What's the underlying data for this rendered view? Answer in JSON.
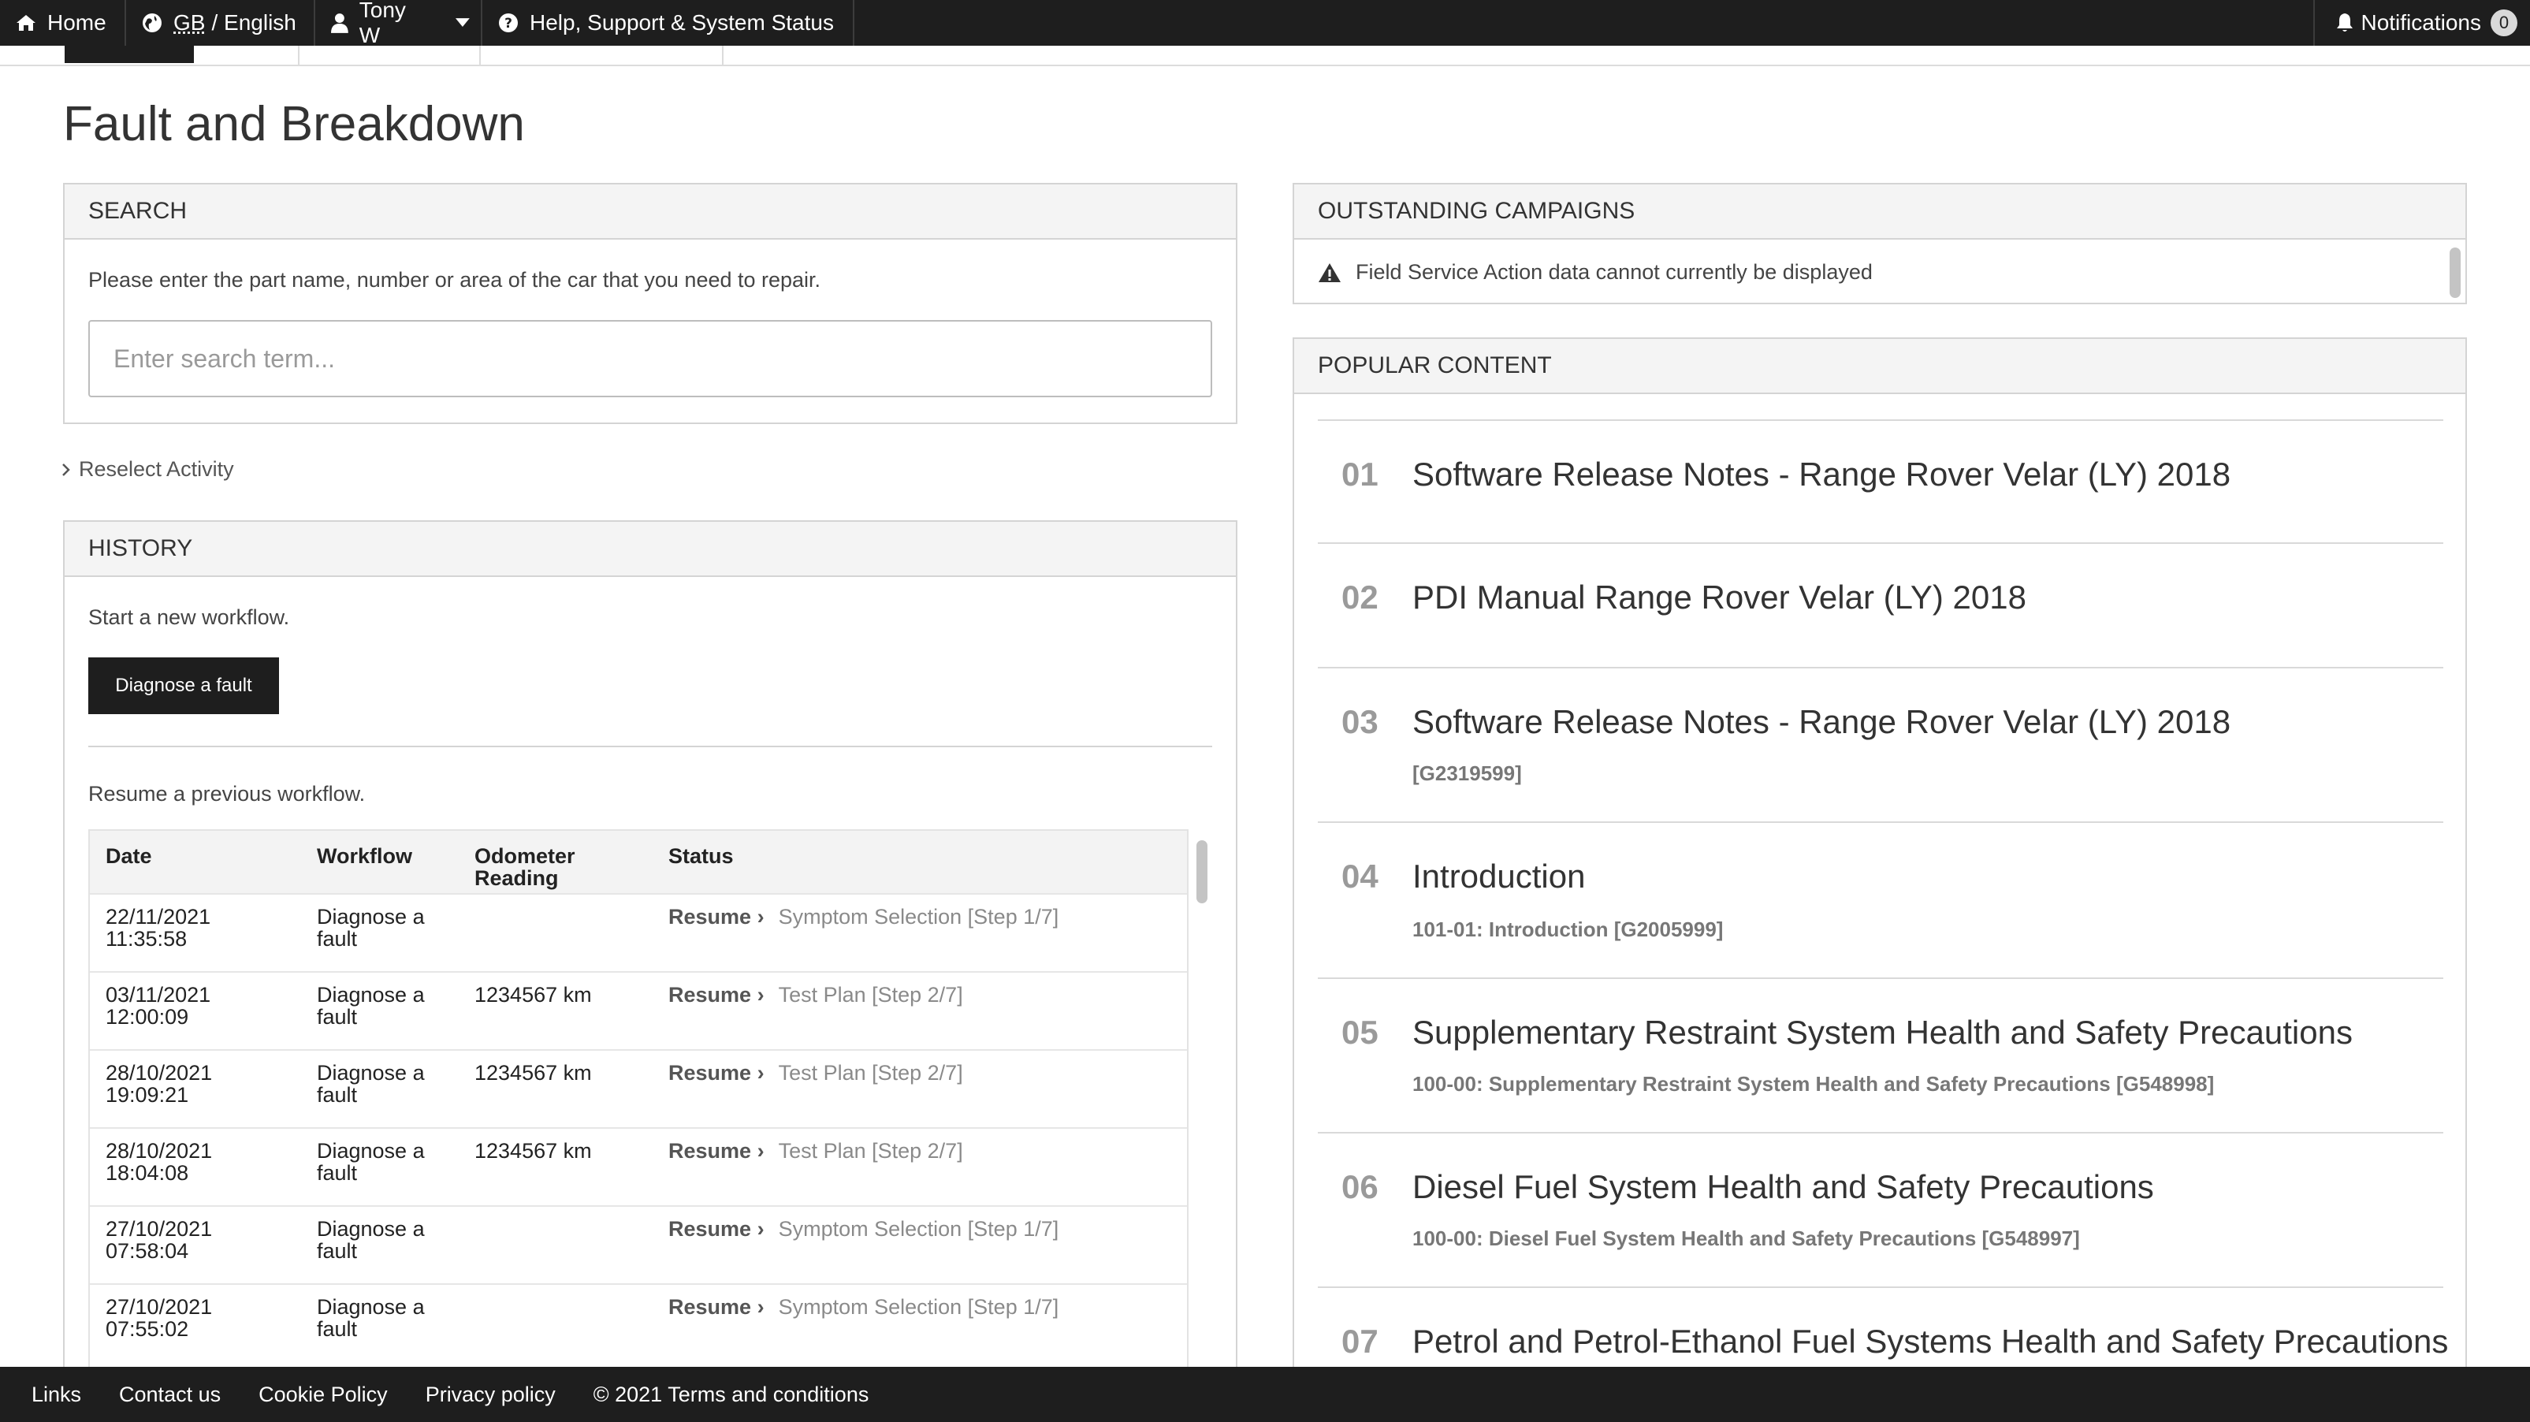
{
  "topbar": {
    "home": "Home",
    "region": "GB",
    "language": "/ English",
    "user": "Tony W",
    "help": "Help, Support & System Status",
    "notifications": "Notifications",
    "notification_count": "0"
  },
  "page_title": "Fault and Breakdown",
  "search": {
    "heading": "SEARCH",
    "instruction": "Please enter the part name, number or area of the car that you need to repair.",
    "placeholder": "Enter search term..."
  },
  "reselect": "Reselect Activity",
  "history": {
    "heading": "HISTORY",
    "start_text": "Start a new workflow.",
    "diagnose_button": "Diagnose a fault",
    "resume_text": "Resume a previous workflow.",
    "columns": [
      "Date",
      "Workflow",
      "Odometer Reading",
      "Status"
    ],
    "resume_label": "Resume",
    "rows": [
      {
        "date": "22/11/2021 11:35:58",
        "workflow": "Diagnose a fault",
        "odometer": "",
        "status": "Symptom Selection [Step 1/7]"
      },
      {
        "date": "03/11/2021 12:00:09",
        "workflow": "Diagnose a fault",
        "odometer": "1234567 km",
        "status": "Test Plan [Step 2/7]"
      },
      {
        "date": "28/10/2021 19:09:21",
        "workflow": "Diagnose a fault",
        "odometer": "1234567 km",
        "status": "Test Plan [Step 2/7]"
      },
      {
        "date": "28/10/2021 18:04:08",
        "workflow": "Diagnose a fault",
        "odometer": "1234567 km",
        "status": "Test Plan [Step 2/7]"
      },
      {
        "date": "27/10/2021 07:58:04",
        "workflow": "Diagnose a fault",
        "odometer": "",
        "status": "Symptom Selection [Step 1/7]"
      },
      {
        "date": "27/10/2021 07:55:02",
        "workflow": "Diagnose a fault",
        "odometer": "",
        "status": "Symptom Selection [Step 1/7]"
      }
    ]
  },
  "campaigns": {
    "heading": "OUTSTANDING CAMPAIGNS",
    "message": "Field Service Action data cannot currently be displayed"
  },
  "popular": {
    "heading": "POPULAR CONTENT",
    "items": [
      {
        "num": "01",
        "title": "Software Release Notes - Range Rover Velar (LY) 2018",
        "sub": ""
      },
      {
        "num": "02",
        "title": "PDI Manual Range Rover Velar (LY) 2018",
        "sub": ""
      },
      {
        "num": "03",
        "title": "Software Release Notes - Range Rover Velar (LY) 2018",
        "sub": "[G2319599]"
      },
      {
        "num": "04",
        "title": "Introduction",
        "sub": "101-01: Introduction [G2005999]"
      },
      {
        "num": "05",
        "title": "Supplementary Restraint System Health and Safety Precautions",
        "sub": "100-00: Supplementary Restraint System Health and Safety Precautions [G548998]"
      },
      {
        "num": "06",
        "title": "Diesel Fuel System Health and Safety Precautions",
        "sub": "100-00: Diesel Fuel System Health and Safety Precautions [G548997]"
      },
      {
        "num": "07",
        "title": "Petrol and Petrol-Ethanol Fuel Systems Health and Safety Precautions",
        "sub": ""
      }
    ]
  },
  "footer": {
    "links": "Links",
    "contact": "Contact us",
    "cookie": "Cookie Policy",
    "privacy": "Privacy policy",
    "terms": "© 2021 Terms and conditions"
  }
}
